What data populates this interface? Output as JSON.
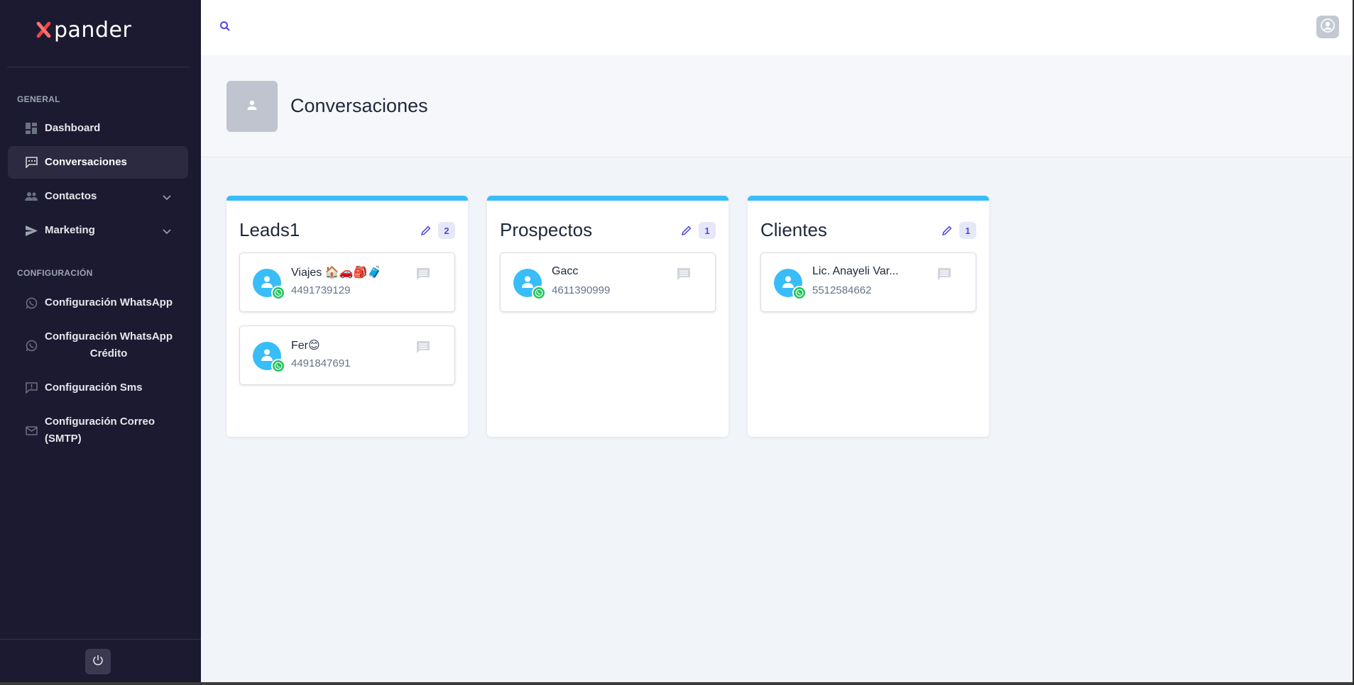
{
  "brand": {
    "logo_text": "pander",
    "accent": "#ef4444"
  },
  "sidebar": {
    "section_general": "GENERAL",
    "section_config": "CONFIGURACIÓN",
    "items": [
      {
        "label": "Dashboard",
        "icon": "dashboard-icon"
      },
      {
        "label": "Conversaciones",
        "icon": "chat-icon",
        "active": true
      },
      {
        "label": "Contactos",
        "icon": "people-icon",
        "expandable": true
      },
      {
        "label": "Marketing",
        "icon": "send-icon",
        "expandable": true
      },
      {
        "label": "Configuración WhatsApp",
        "icon": "whatsapp-icon"
      },
      {
        "label": "Configuración WhatsApp Crédito",
        "icon": "whatsapp-icon"
      },
      {
        "label": "Configuración Sms",
        "icon": "sms-icon"
      },
      {
        "label": "Configuración Correo (SMTP)",
        "icon": "mail-icon"
      }
    ],
    "power_icon": "power-icon"
  },
  "topbar": {
    "search_icon": "search-icon",
    "avatar_icon": "user-icon"
  },
  "page": {
    "title": "Conversaciones"
  },
  "boards": [
    {
      "title": "Leads1",
      "count": "2",
      "cards": [
        {
          "name": "Viajes 🏠🚗🎒🧳",
          "phone": "4491739129"
        },
        {
          "name": "Fer😊",
          "phone": "4491847691"
        }
      ]
    },
    {
      "title": "Prospectos",
      "count": "1",
      "cards": [
        {
          "name": "Gacc",
          "phone": "4611390999"
        }
      ]
    },
    {
      "title": "Clientes",
      "count": "1",
      "cards": [
        {
          "name": "Lic. Anayeli Var...",
          "phone": "5512584662"
        }
      ]
    }
  ],
  "colors": {
    "board_accent": "#38bdf8",
    "whatsapp": "#22c55e",
    "sidebar_bg": "#1c1a31"
  }
}
